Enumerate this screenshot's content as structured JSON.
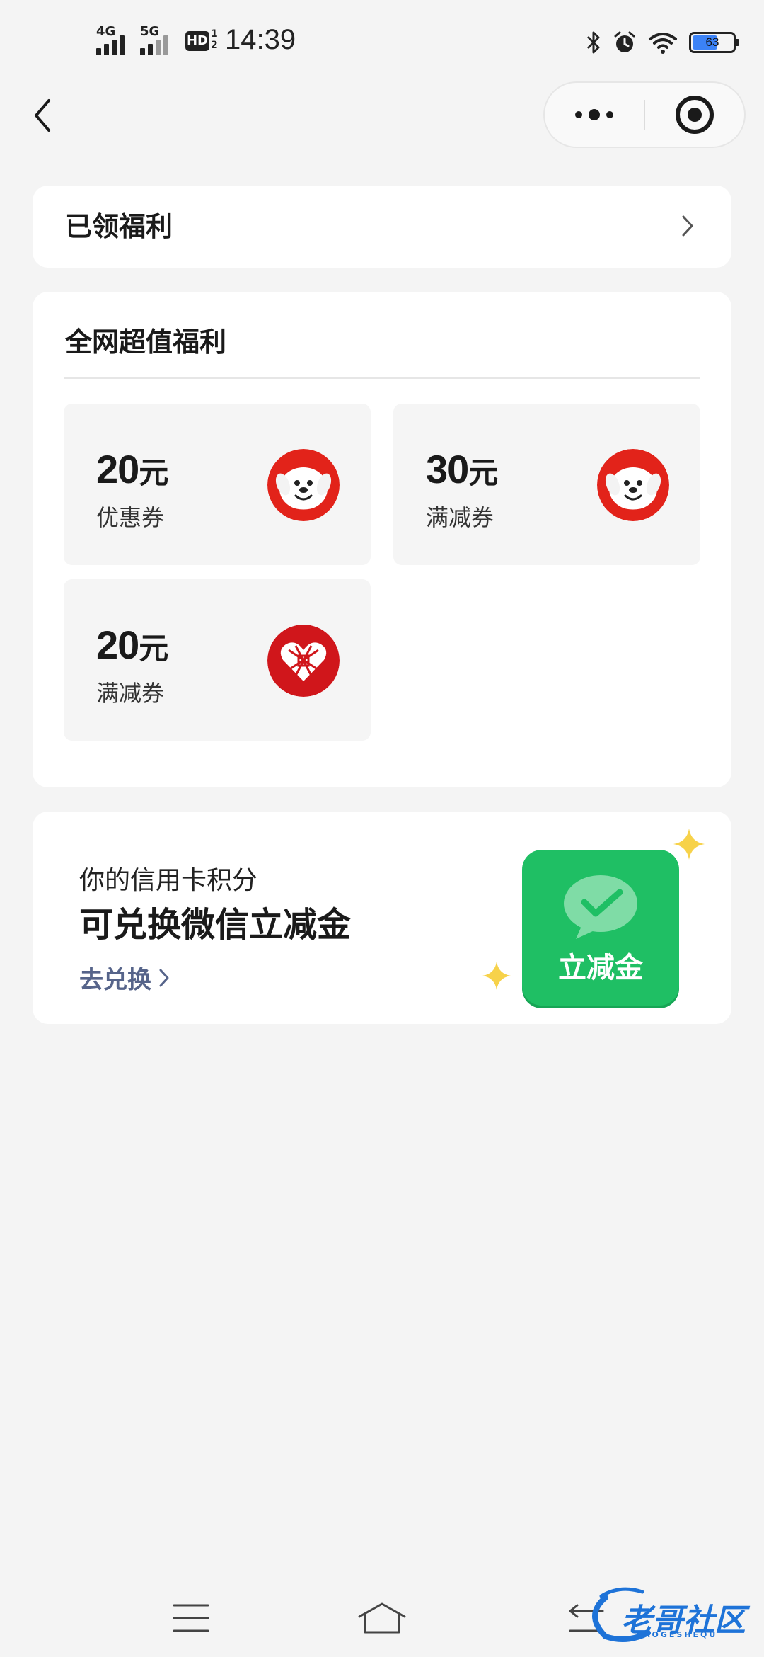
{
  "status_bar": {
    "network_1": "4G",
    "network_2": "5G",
    "hd_badge": "HD",
    "hd_sub_top": "1",
    "hd_sub_bottom": "2",
    "time": "14:39",
    "battery_percent": "63",
    "battery_level": 0.63,
    "battery_color": "#3b82f6"
  },
  "claimed": {
    "title": "已领福利"
  },
  "welfare": {
    "title": "全网超值福利",
    "coupons": [
      {
        "amount": "20",
        "unit": "元",
        "type": "优惠券",
        "logo": "jd-dog-icon"
      },
      {
        "amount": "30",
        "unit": "元",
        "type": "满减券",
        "logo": "jd-dog-icon"
      },
      {
        "amount": "20",
        "unit": "元",
        "type": "满减券",
        "logo": "pinduoduo-heart-icon"
      }
    ]
  },
  "points": {
    "subtitle": "你的信用卡积分",
    "headline": "可兑换微信立减金",
    "link": "去兑换",
    "tile_label": "立减金",
    "brand_green": "#1fbf64",
    "link_color": "#56648a"
  },
  "watermark": {
    "text": "老哥社区",
    "subtext": "LAOGESHEQU"
  }
}
